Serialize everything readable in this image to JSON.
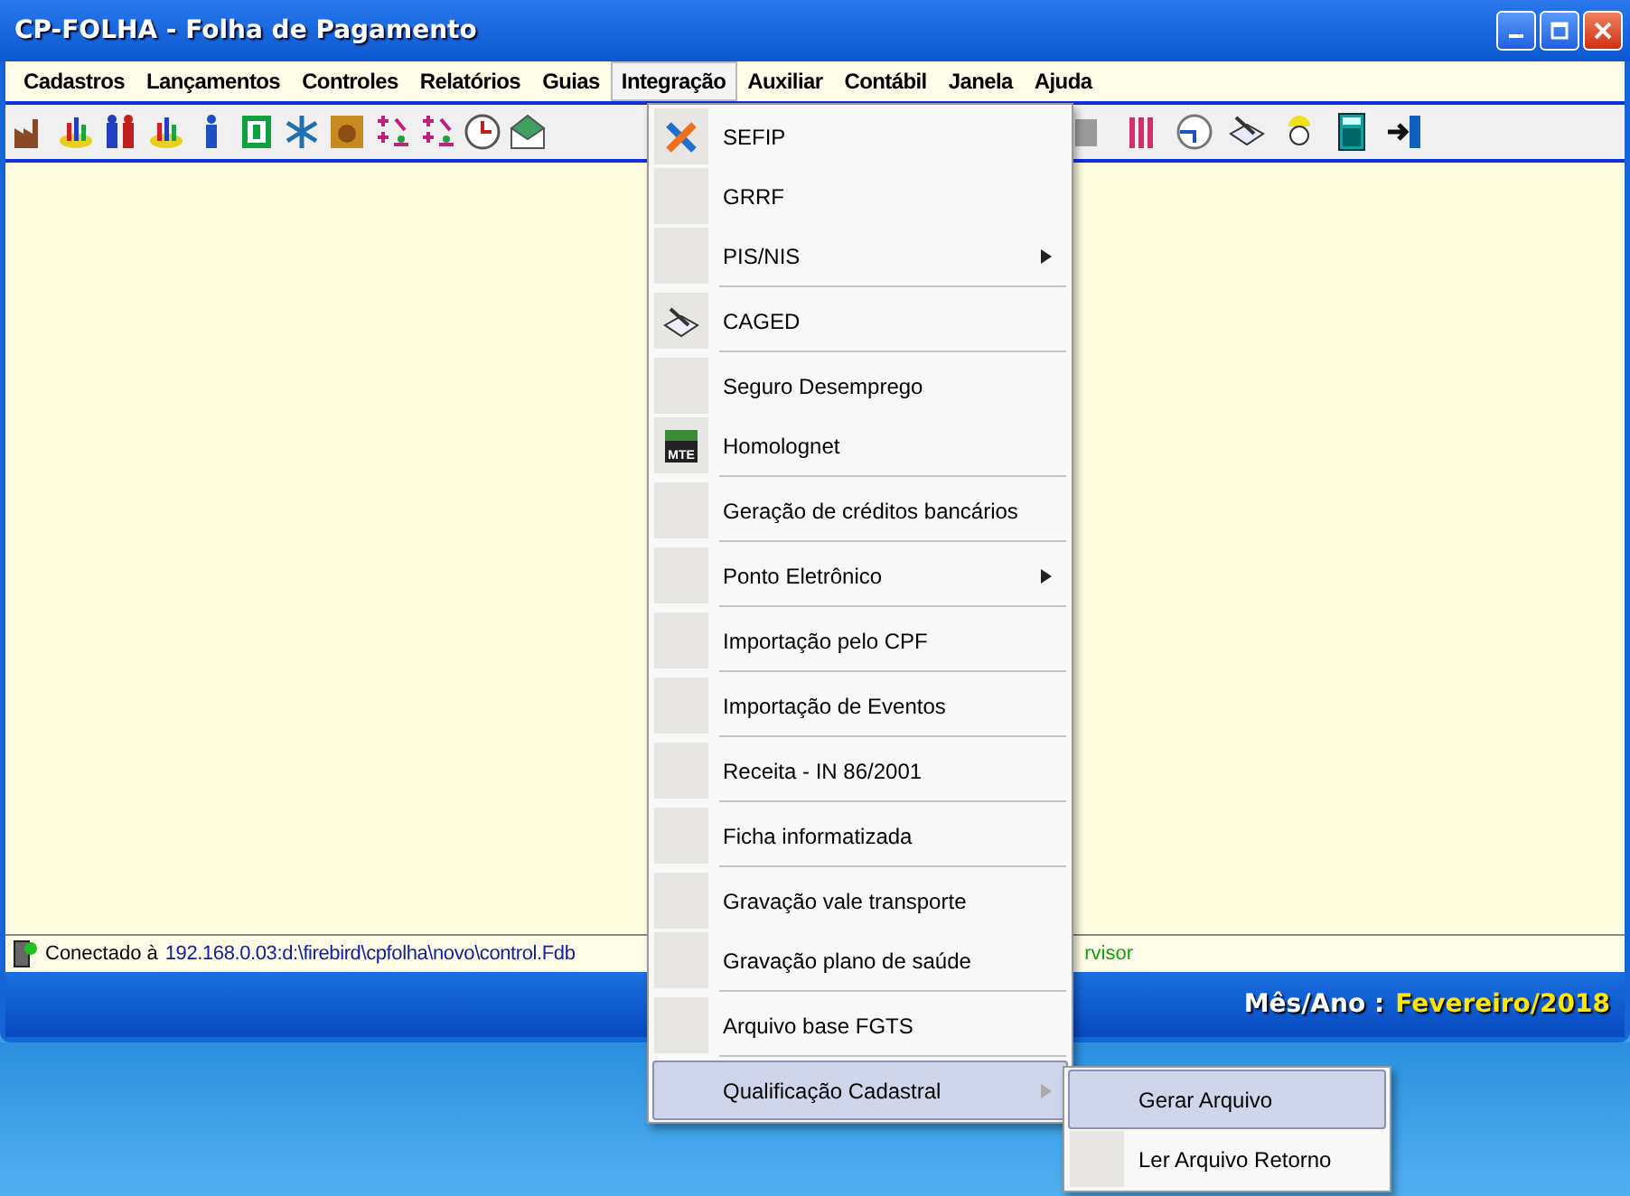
{
  "window": {
    "title": "CP-FOLHA - Folha de Pagamento"
  },
  "menu_bar": [
    {
      "label": "Cadastros",
      "selected": false
    },
    {
      "label": "Lançamentos",
      "selected": false
    },
    {
      "label": "Controles",
      "selected": false
    },
    {
      "label": "Relatórios",
      "selected": false
    },
    {
      "label": "Guias",
      "selected": false
    },
    {
      "label": "Integração",
      "selected": true
    },
    {
      "label": "Auxiliar",
      "selected": false
    },
    {
      "label": "Contábil",
      "selected": false
    },
    {
      "label": "Janela",
      "selected": false
    },
    {
      "label": "Ajuda",
      "selected": false
    }
  ],
  "dropdown": [
    {
      "label": "SEFIP",
      "submenu": false,
      "separator_after": false,
      "selected": false
    },
    {
      "label": "GRRF",
      "submenu": false,
      "separator_after": false,
      "selected": false
    },
    {
      "label": "PIS/NIS",
      "submenu": true,
      "separator_after": true,
      "selected": false
    },
    {
      "label": "CAGED",
      "submenu": false,
      "separator_after": true,
      "selected": false
    },
    {
      "label": "Seguro Desemprego",
      "submenu": false,
      "separator_after": false,
      "selected": false
    },
    {
      "label": "Homolognet",
      "icon_label": "MTE",
      "submenu": false,
      "separator_after": true,
      "selected": false
    },
    {
      "label": "Geração de créditos bancários",
      "submenu": false,
      "separator_after": true,
      "selected": false
    },
    {
      "label": "Ponto Eletrônico",
      "submenu": true,
      "separator_after": true,
      "selected": false
    },
    {
      "label": "Importação pelo CPF",
      "submenu": false,
      "separator_after": true,
      "selected": false
    },
    {
      "label": "Importação de Eventos",
      "submenu": false,
      "separator_after": true,
      "selected": false
    },
    {
      "label": "Receita - IN 86/2001",
      "submenu": false,
      "separator_after": true,
      "selected": false
    },
    {
      "label": "Ficha informatizada",
      "submenu": false,
      "separator_after": true,
      "selected": false
    },
    {
      "label": "Gravação vale transporte",
      "submenu": false,
      "separator_after": false,
      "selected": false
    },
    {
      "label": "Gravação plano de saúde",
      "submenu": false,
      "separator_after": true,
      "selected": false
    },
    {
      "label": "Arquivo base FGTS",
      "submenu": false,
      "separator_after": true,
      "selected": false
    },
    {
      "label": "Qualificação Cadastral",
      "submenu": true,
      "separator_after": false,
      "selected": true
    }
  ],
  "submenu": [
    {
      "label": "Gerar Arquivo",
      "selected": true
    },
    {
      "label": "Ler Arquivo Retorno",
      "selected": false
    }
  ],
  "status_bar": {
    "connection": "Conectado à",
    "path": "192.168.0.03:d:\\firebird\\cpfolha\\novo\\control.Fdb",
    "user_fragment": "rvisor"
  },
  "period": {
    "label": "Mês/Ano :",
    "value": "Fevereiro/2018"
  }
}
